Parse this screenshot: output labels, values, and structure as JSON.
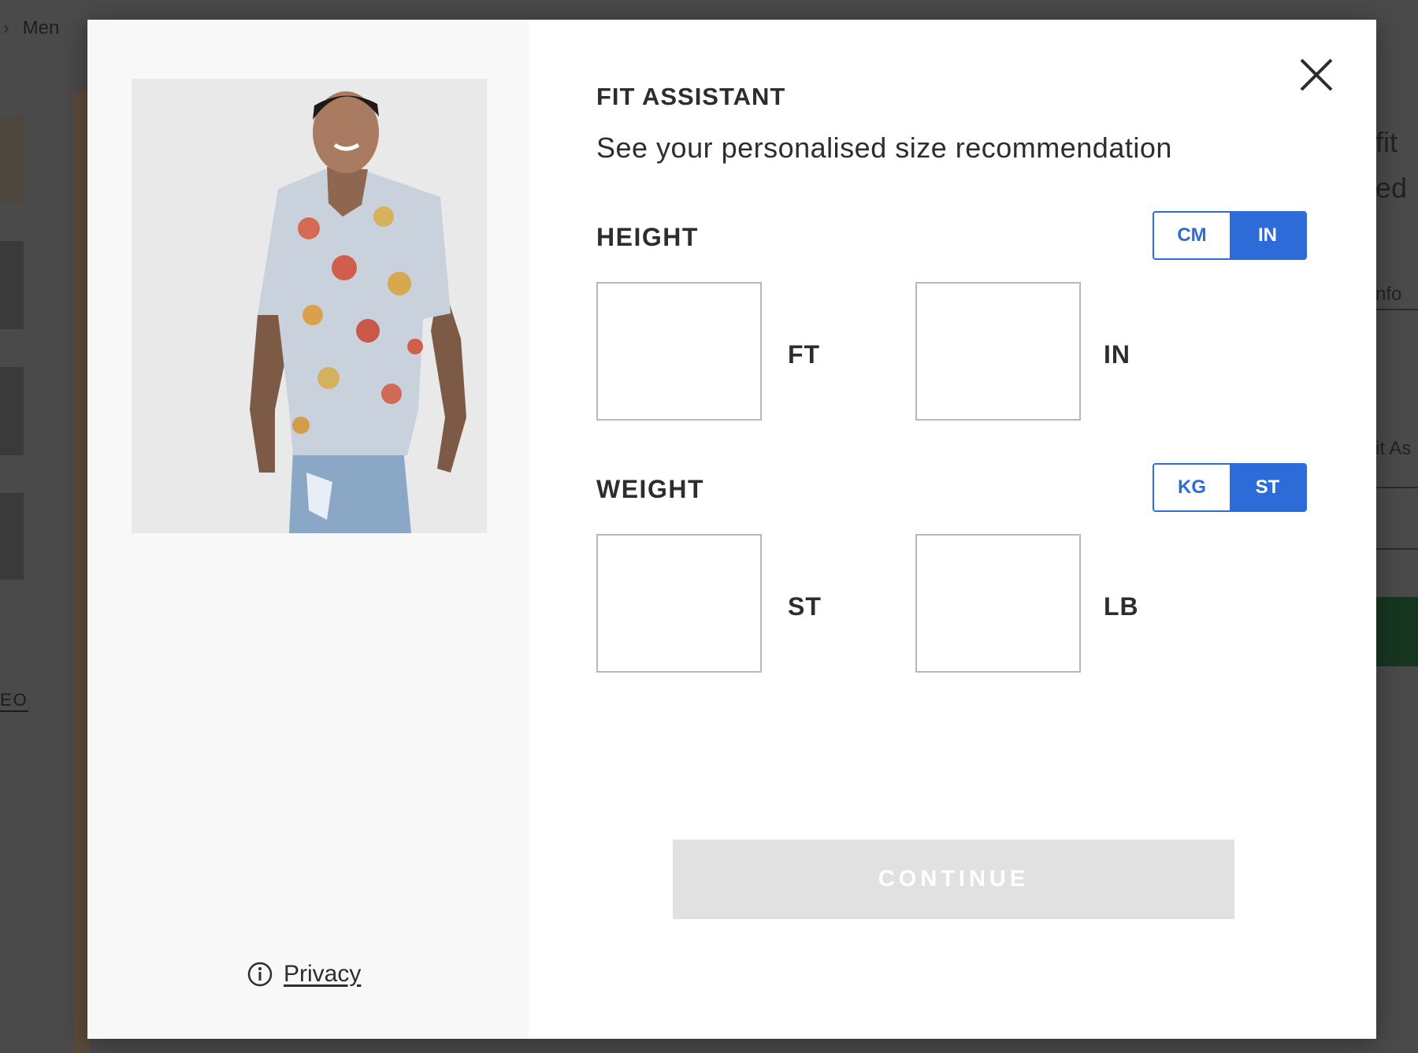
{
  "background": {
    "breadcrumb": {
      "separator": "›",
      "current": "Men"
    },
    "video_label": "EO",
    "right_fragments": [
      "fit",
      "ed",
      "nfo",
      "it As"
    ]
  },
  "modal": {
    "title": "FIT ASSISTANT",
    "subtitle": "See your personalised size recommendation",
    "close_icon": "close-icon",
    "height": {
      "label": "HEIGHT",
      "unit_toggle": {
        "options": [
          "CM",
          "IN"
        ],
        "selected": "IN"
      },
      "fields": [
        {
          "value": "",
          "unit": "FT"
        },
        {
          "value": "",
          "unit": "IN"
        }
      ]
    },
    "weight": {
      "label": "WEIGHT",
      "unit_toggle": {
        "options": [
          "KG",
          "ST"
        ],
        "selected": "ST"
      },
      "fields": [
        {
          "value": "",
          "unit": "ST"
        },
        {
          "value": "",
          "unit": "LB"
        }
      ]
    },
    "continue_label": "CONTINUE",
    "privacy": {
      "icon": "info-icon",
      "label": "Privacy"
    }
  },
  "colors": {
    "accent": "#2d6bd8",
    "text": "#2d2d2d",
    "disabled_button": "#e1e1e1",
    "left_panel": "#f8f8f8"
  }
}
